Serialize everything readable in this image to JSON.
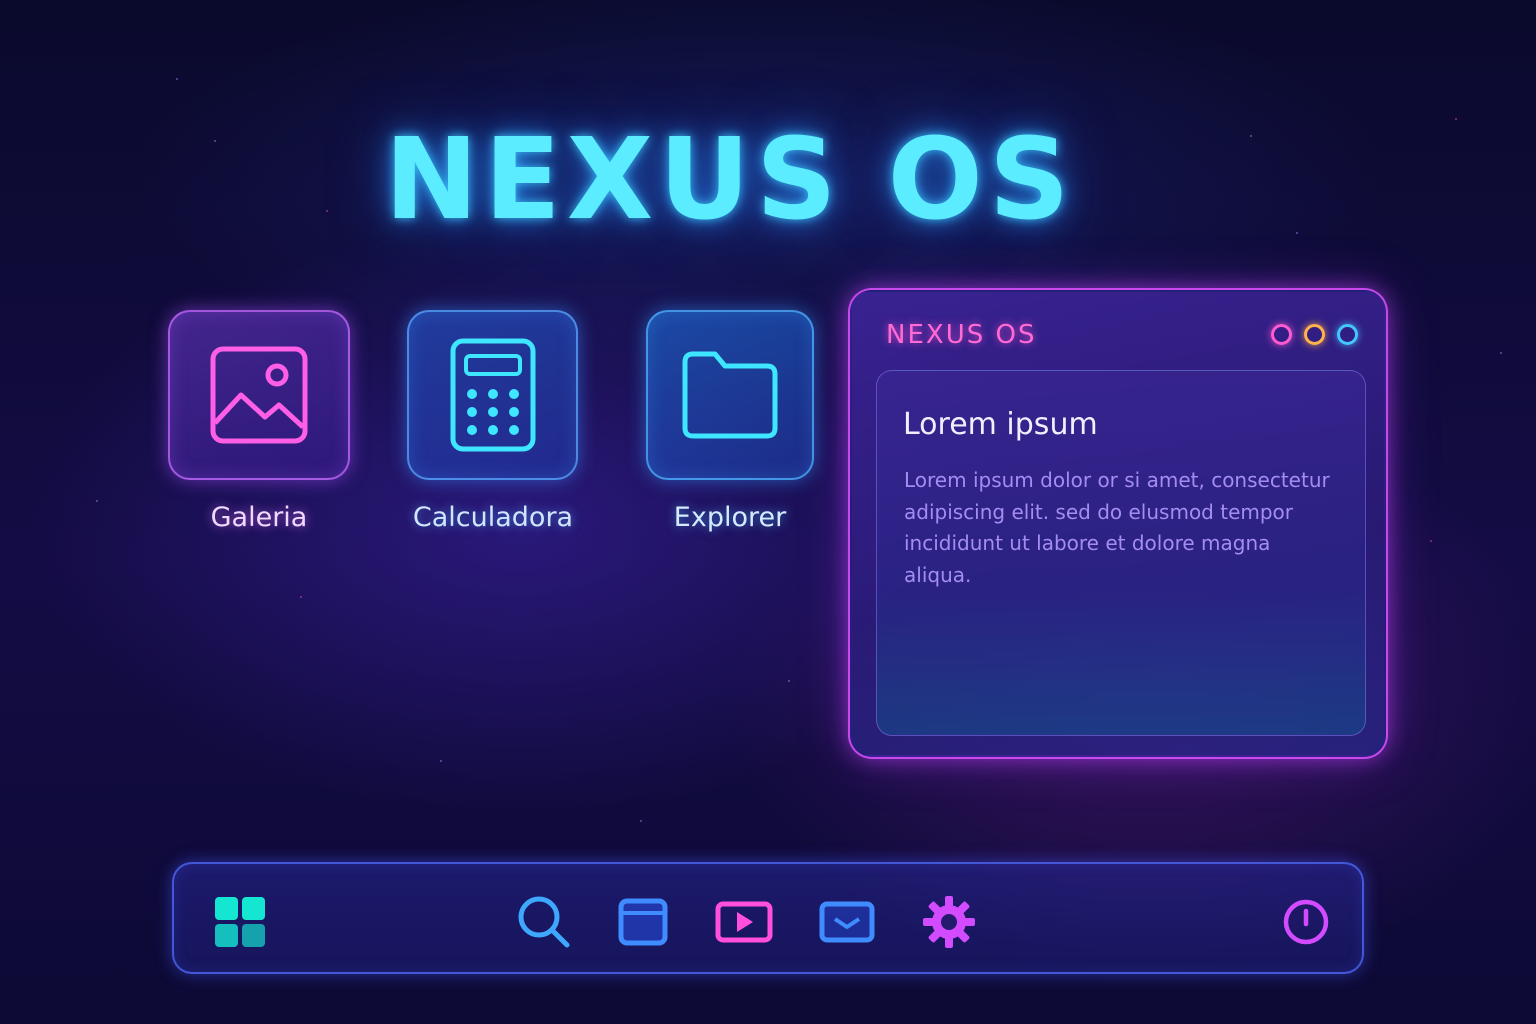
{
  "desktop": {
    "title": "NEXUS OS"
  },
  "apps": [
    {
      "label": "Galeria",
      "icon": "image-icon"
    },
    {
      "label": "Calculadora",
      "icon": "calculator-icon"
    },
    {
      "label": "Explorer",
      "icon": "folder-icon"
    }
  ],
  "window": {
    "title": "NEXUS OS",
    "controls": [
      "close-dot",
      "minimize-dot",
      "maximize-dot"
    ],
    "heading": "Lorem ipsum",
    "body": "Lorem ipsum dolor or si amet, consectetur adipiscing elit. sed do elusmod tempor incididunt ut labore et dolore magna aliqua."
  },
  "taskbar": {
    "items": [
      "start-icon",
      "search-icon",
      "window-icon",
      "video-icon",
      "mail-icon",
      "gear-icon",
      "power-icon"
    ]
  },
  "colors": {
    "cyan": "#5cecff",
    "pink": "#ff5ad0",
    "orange": "#ffb34a",
    "blue": "#43c7ff",
    "purple": "#b05cff",
    "teal": "#14e6d2"
  }
}
